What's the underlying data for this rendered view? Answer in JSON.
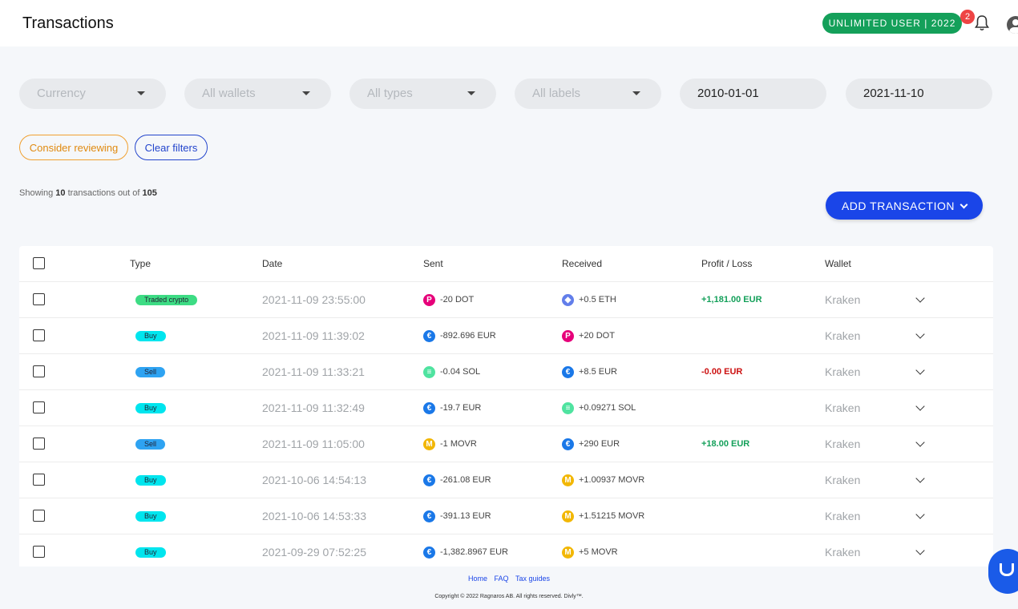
{
  "header": {
    "title": "Transactions",
    "plan_badge": "UNLIMITED USER | 2022",
    "notification_count": "2",
    "icons": [
      "bell-icon",
      "user-icon"
    ]
  },
  "filters": {
    "currency": "Currency",
    "wallets": "All wallets",
    "types": "All types",
    "labels": "All labels",
    "date_from": "2010-01-01",
    "date_to": "2021-11-10"
  },
  "actions": {
    "consider_reviewing": "Consider reviewing",
    "clear_filters": "Clear filters",
    "add_transaction": "ADD TRANSACTION"
  },
  "summary": {
    "prefix": "Showing",
    "shown": "10",
    "middle": "transactions out of",
    "total": "105"
  },
  "table": {
    "columns": [
      "Type",
      "Date",
      "Sent",
      "Received",
      "Profit / Loss",
      "Wallet"
    ],
    "rows": [
      {
        "type": "Traded crypto",
        "date": "2021-11-09 23:55:00",
        "sent": "-20 DOT",
        "sent_coin": "DOT",
        "received": "+0.5 ETH",
        "received_coin": "ETH",
        "pl": "+1,181.00 EUR",
        "wallet": "Kraken"
      },
      {
        "type": "Buy",
        "date": "2021-11-09 11:39:02",
        "sent": "-892.696 EUR",
        "sent_coin": "EUR",
        "received": "+20 DOT",
        "received_coin": "DOT",
        "pl": "",
        "wallet": "Kraken"
      },
      {
        "type": "Sell",
        "date": "2021-11-09 11:33:21",
        "sent": "-0.04 SOL",
        "sent_coin": "SOL",
        "received": "+8.5 EUR",
        "received_coin": "EUR",
        "pl": "-0.00 EUR",
        "wallet": "Kraken"
      },
      {
        "type": "Buy",
        "date": "2021-11-09 11:32:49",
        "sent": "-19.7 EUR",
        "sent_coin": "EUR",
        "received": "+0.09271 SOL",
        "received_coin": "SOL",
        "pl": "",
        "wallet": "Kraken"
      },
      {
        "type": "Sell",
        "date": "2021-11-09 11:05:00",
        "sent": "-1 MOVR",
        "sent_coin": "MOVR",
        "received": "+290 EUR",
        "received_coin": "EUR",
        "pl": "+18.00 EUR",
        "wallet": "Kraken"
      },
      {
        "type": "Buy",
        "date": "2021-10-06 14:54:13",
        "sent": "-261.08 EUR",
        "sent_coin": "EUR",
        "received": "+1.00937 MOVR",
        "received_coin": "MOVR",
        "pl": "",
        "wallet": "Kraken"
      },
      {
        "type": "Buy",
        "date": "2021-10-06 14:53:33",
        "sent": "-391.13 EUR",
        "sent_coin": "EUR",
        "received": "+1.51215 MOVR",
        "received_coin": "MOVR",
        "pl": "",
        "wallet": "Kraken"
      },
      {
        "type": "Buy",
        "date": "2021-09-29 07:52:25",
        "sent": "-1,382.8967 EUR",
        "sent_coin": "EUR",
        "received": "+5 MOVR",
        "received_coin": "MOVR",
        "pl": "",
        "wallet": "Kraken"
      }
    ]
  },
  "colors": {
    "accent": "#1a45e8",
    "plan_green": "#14a05a",
    "profit": "#14a05a",
    "loss": "#cc1111",
    "tag_buy": "#00e5ee",
    "tag_sell": "#2ea3f2",
    "tag_traded": "#3ddc84",
    "coin_DOT": "#e6007a",
    "coin_ETH": "#627eea",
    "coin_EUR": "#1a78e8",
    "coin_SOL": "#4fe3a0",
    "coin_MOVR": "#f2b705"
  },
  "footer": {
    "links": [
      "Home",
      "FAQ",
      "Tax guides"
    ],
    "copyright": "Copyright © 2022 Ragnaros AB. All rights reserved. Divly™."
  },
  "chat": {
    "icon": "chat-icon"
  }
}
